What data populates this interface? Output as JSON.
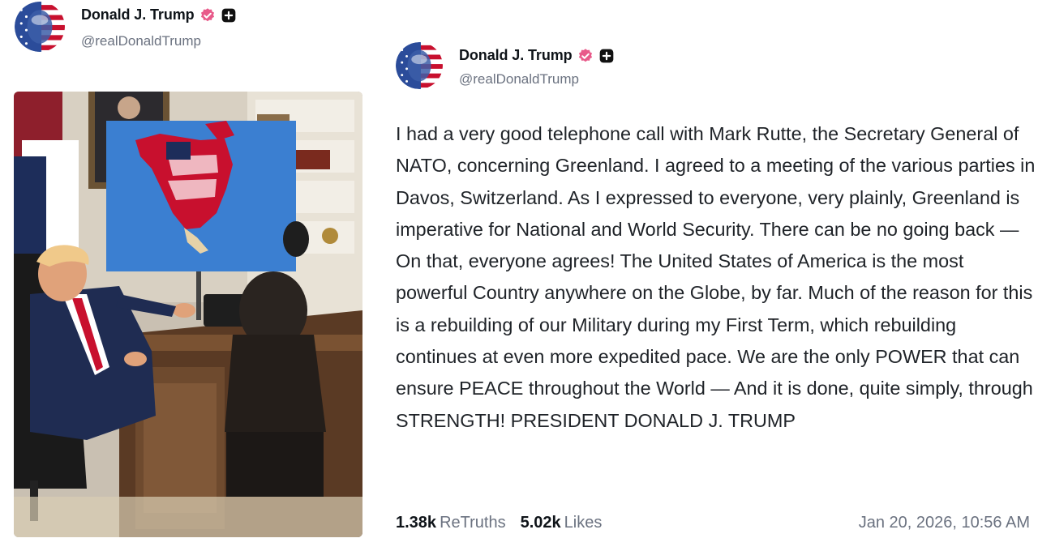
{
  "left_post": {
    "author": {
      "display_name": "Donald J. Trump",
      "handle": "@realDonaldTrump"
    },
    "badges": [
      "verified-badge-icon",
      "plus-badge-icon"
    ],
    "image": {
      "kind": "photo"
    }
  },
  "right_post": {
    "author": {
      "display_name": "Donald J. Trump",
      "handle": "@realDonaldTrump"
    },
    "badges": [
      "verified-badge-icon",
      "plus-badge-icon"
    ],
    "body": "I had a very good telephone call with Mark Rutte, the Secretary General of NATO, concerning Greenland. I agreed to a meeting of the various parties in Davos, Switzerland. As I expressed to everyone, very plainly, Greenland is imperative for National and World Security. There can be no going back — On that, everyone agrees! The United States of America is the most powerful Country anywhere on the Globe, by far. Much of the reason for this is a rebuilding of our Military during my First Term, which rebuilding continues at even more expedited pace. We are the only POWER that can ensure PEACE throughout the World — And it is done, quite simply, through STRENGTH! PRESIDENT DONALD J. TRUMP",
    "stats": {
      "retruths_count": "1.38k",
      "retruths_label": "ReTruths",
      "likes_count": "5.02k",
      "likes_label": "Likes"
    },
    "timestamp": "Jan 20, 2026, 10:56 AM"
  },
  "colors": {
    "verified": "#e85a8a",
    "text": "#0f1419",
    "muted": "#6b7280"
  }
}
